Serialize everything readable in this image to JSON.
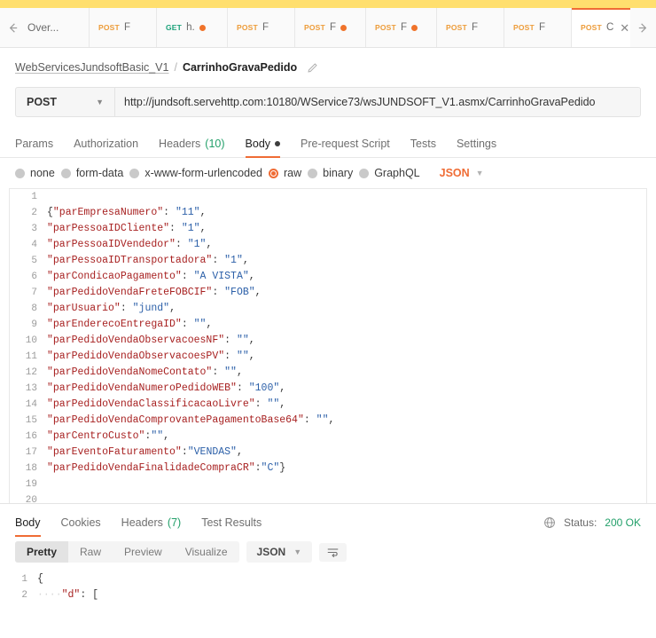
{
  "window": {
    "banner_color": "#ffdf6e"
  },
  "tabbar": {
    "back_icon": "arrow-left-icon",
    "forward_icon": "arrow-right-icon",
    "tabs": [
      {
        "method": "",
        "name": "Over...",
        "unsaved": false,
        "active": false
      },
      {
        "method": "POST",
        "name": "F",
        "unsaved": false,
        "active": false
      },
      {
        "method": "GET",
        "name": "h.",
        "unsaved": true,
        "active": false
      },
      {
        "method": "POST",
        "name": "F",
        "unsaved": false,
        "active": false
      },
      {
        "method": "POST",
        "name": "F",
        "unsaved": true,
        "active": false
      },
      {
        "method": "POST",
        "name": "F",
        "unsaved": true,
        "active": false
      },
      {
        "method": "POST",
        "name": "F",
        "unsaved": false,
        "active": false
      },
      {
        "method": "POST",
        "name": "F",
        "unsaved": false,
        "active": false
      },
      {
        "method": "POST",
        "name": "C",
        "unsaved": false,
        "active": true,
        "close_icon": "close-icon"
      }
    ]
  },
  "breadcrumb": {
    "parent": "WebServicesJundsoftBasic_V1",
    "separator": "/",
    "current": "CarrinhoGravaPedido",
    "edit_icon": "pencil-icon"
  },
  "url_bar": {
    "method": "POST",
    "method_chevron": "chevron-down-icon",
    "url": "http://jundsoft.servehttp.com:10180/WService73/wsJUNDSOFT_V1.asmx/CarrinhoGravaPedido"
  },
  "request_tabs": [
    {
      "label": "Params",
      "active": false
    },
    {
      "label": "Authorization",
      "active": false
    },
    {
      "label": "Headers",
      "count": "(10)",
      "active": false
    },
    {
      "label": "Body",
      "dot": true,
      "active": true
    },
    {
      "label": "Pre-request Script",
      "active": false
    },
    {
      "label": "Tests",
      "active": false
    },
    {
      "label": "Settings",
      "active": false
    }
  ],
  "body_types": {
    "options": [
      {
        "label": "none",
        "selected": false
      },
      {
        "label": "form-data",
        "selected": false
      },
      {
        "label": "x-www-form-urlencoded",
        "selected": false
      },
      {
        "label": "raw",
        "selected": true
      },
      {
        "label": "binary",
        "selected": false
      },
      {
        "label": "GraphQL",
        "selected": false
      }
    ],
    "language": "JSON",
    "language_chevron": "chevron-down-icon"
  },
  "request_body": {
    "lines": [
      {
        "n": "1",
        "text": ""
      },
      {
        "n": "2",
        "text": "{\"parEmpresaNumero\": \"11\","
      },
      {
        "n": "3",
        "text": "\"parPessoaIDCliente\": \"1\","
      },
      {
        "n": "4",
        "text": "\"parPessoaIDVendedor\": \"1\","
      },
      {
        "n": "5",
        "text": "\"parPessoaIDTransportadora\": \"1\","
      },
      {
        "n": "6",
        "text": "\"parCondicaoPagamento\": \"A VISTA\","
      },
      {
        "n": "7",
        "text": "\"parPedidoVendaFreteFOBCIF\": \"FOB\","
      },
      {
        "n": "8",
        "text": "\"parUsuario\": \"jund\","
      },
      {
        "n": "9",
        "text": "\"parEnderecoEntregaID\": \"\","
      },
      {
        "n": "10",
        "text": "\"parPedidoVendaObservacoesNF\": \"\","
      },
      {
        "n": "11",
        "text": "\"parPedidoVendaObservacoesPV\": \"\","
      },
      {
        "n": "12",
        "text": "\"parPedidoVendaNomeContato\": \"\","
      },
      {
        "n": "13",
        "text": "\"parPedidoVendaNumeroPedidoWEB\": \"100\","
      },
      {
        "n": "14",
        "text": "\"parPedidoVendaClassificacaoLivre\": \"\","
      },
      {
        "n": "15",
        "text": "\"parPedidoVendaComprovantePagamentoBase64\": \"\","
      },
      {
        "n": "16",
        "text": "\"parCentroCusto\":\"\","
      },
      {
        "n": "17",
        "text": "\"parEventoFaturamento\":\"VENDAS\","
      },
      {
        "n": "18",
        "text": "\"parPedidoVendaFinalidadeCompraCR\":\"C\"}"
      },
      {
        "n": "19",
        "text": ""
      },
      {
        "n": "20",
        "text": ""
      }
    ]
  },
  "response": {
    "tabs": [
      {
        "label": "Body",
        "active": true
      },
      {
        "label": "Cookies",
        "active": false
      },
      {
        "label": "Headers",
        "count": "(7)",
        "active": false
      },
      {
        "label": "Test Results",
        "active": false
      }
    ],
    "globe_icon": "globe-icon",
    "status_label": "Status:",
    "status_value": "200 OK",
    "status_color": "#23a06a",
    "toolbar": {
      "views": [
        {
          "label": "Pretty",
          "active": true
        },
        {
          "label": "Raw",
          "active": false
        },
        {
          "label": "Preview",
          "active": false
        },
        {
          "label": "Visualize",
          "active": false
        }
      ],
      "language": "JSON",
      "language_chevron": "chevron-down-icon",
      "wrap_icon": "wrap-lines-icon"
    },
    "body_lines": [
      {
        "n": "1",
        "indent": "",
        "text": "{"
      },
      {
        "n": "2",
        "indent": "····",
        "text": "\"d\": ["
      }
    ]
  }
}
